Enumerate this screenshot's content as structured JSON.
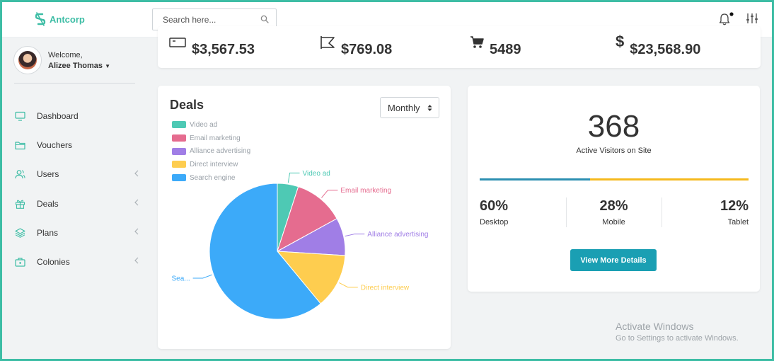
{
  "brand": {
    "name": "Antcorp",
    "logo_icon": "s-logo-icon",
    "color": "#3dbda5"
  },
  "search": {
    "placeholder": "Search here..."
  },
  "header_icons": {
    "notifications": "bell-icon",
    "settings": "sliders-icon",
    "notification_dot": true
  },
  "profile": {
    "welcome": "Welcome,",
    "name": "Alizee Thomas"
  },
  "sidebar": {
    "items": [
      {
        "label": "Dashboard",
        "icon": "monitor-icon",
        "has_chevron": false
      },
      {
        "label": "Vouchers",
        "icon": "folder-icon",
        "has_chevron": false
      },
      {
        "label": "Users",
        "icon": "users-icon",
        "has_chevron": true
      },
      {
        "label": "Deals",
        "icon": "gift-icon",
        "has_chevron": true
      },
      {
        "label": "Plans",
        "icon": "layers-icon",
        "has_chevron": true
      },
      {
        "label": "Colonies",
        "icon": "briefcase-icon",
        "has_chevron": true
      }
    ]
  },
  "stats": [
    {
      "value": "$3,567.53",
      "icon": "wallet-icon"
    },
    {
      "value": "$769.08",
      "icon": "flag-icon"
    },
    {
      "value": "5489",
      "icon": "cart-icon"
    },
    {
      "value": "$23,568.90",
      "icon": "dollar-icon"
    }
  ],
  "deals": {
    "title": "Deals",
    "period": {
      "selected": "Monthly"
    }
  },
  "chart_data": {
    "type": "pie",
    "title": "",
    "categories": [
      "Video ad",
      "Email marketing",
      "Alliance advertising",
      "Direct interview",
      "Search engine"
    ],
    "values": [
      5,
      12,
      9,
      13,
      61
    ],
    "colors": [
      "#4ec9b4",
      "#e56c8f",
      "#a07ee6",
      "#fecd4f",
      "#3caaf9"
    ],
    "labels": [
      "Video ad",
      "Email marketing",
      "Alliance advertising",
      "Direct interview",
      "Sea..."
    ],
    "legend": "top-left"
  },
  "visitors": {
    "count": "368",
    "label": "Active Visitors on Site",
    "progress": [
      {
        "fraction": 0.41,
        "color": "#2c8fb1"
      },
      {
        "fraction": 0.59,
        "color": "#f5b91e"
      }
    ],
    "devices": [
      {
        "pct": "60%",
        "name": "Desktop"
      },
      {
        "pct": "28%",
        "name": "Mobile"
      },
      {
        "pct": "12%",
        "name": "Tablet"
      }
    ],
    "button_label": "View More Details"
  },
  "watermark": {
    "title": "Activate Windows",
    "subtitle": "Go to Settings to activate Windows."
  }
}
